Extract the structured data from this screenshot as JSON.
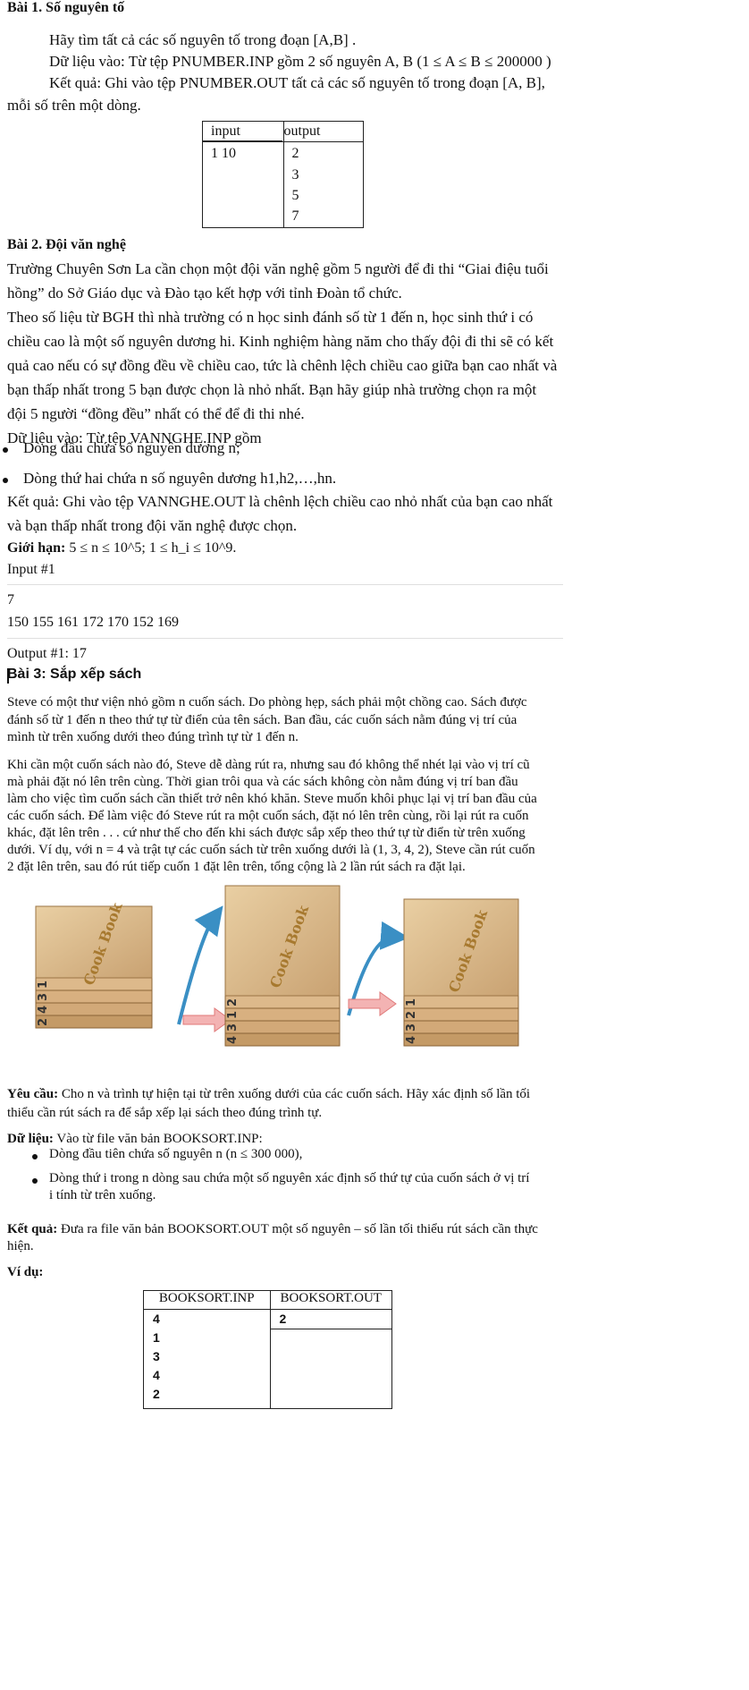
{
  "bai1": {
    "title": "Bài 1. Số nguyên tố",
    "p1": "Hãy tìm tất cả các số nguyên tố trong đoạn [A,B] .",
    "p2": "Dữ liệu vào: Từ tệp PNUMBER.INP gồm 2 số nguyên A, B (1 ≤ A ≤ B ≤ 200000 )",
    "p3a": "Kết quả: Ghi vào tệp PNUMBER.OUT tất cả các số nguyên tố trong đoạn [A, B],",
    "p3b": "mỗi số trên một dòng.",
    "table": {
      "headers": [
        "input",
        "output"
      ],
      "input_lines": [
        "1 10"
      ],
      "output_lines": [
        "2",
        "3",
        "5",
        "7"
      ]
    }
  },
  "bai2": {
    "title": "Bài 2. Đội văn nghệ",
    "lines": [
      "Trường Chuyên Sơn La cần chọn một đội văn nghệ gồm 5 người để đi thi “Giai điệu tuổi",
      "hồng” do Sở Giáo dục và Đào tạo kết hợp với tỉnh Đoàn tổ chức.",
      "Theo số liệu từ BGH thì nhà trường có n học sinh đánh số từ 1 đến n, học sinh thứ i có",
      "chiều cao là một số nguyên dương hi. Kinh nghiệm hàng năm cho thấy đội đi thi sẽ có kết",
      "quả cao nếu có sự đồng đều về chiều cao, tức là chênh lệch chiều cao giữa bạn cao nhất và",
      "bạn thấp nhất trong 5 bạn được chọn là nhỏ nhất. Bạn hãy giúp nhà trường chọn ra một",
      "đội 5 người “đồng đều” nhất có thể để đi thi nhé.",
      "Dữ liệu vào: Từ tệp VANNGHE.INP gồm"
    ],
    "bullets": [
      "Dòng đầu chứa số nguyên dương n;",
      "Dòng thứ hai chứa n số nguyên dương h1,h2,…,hn."
    ],
    "result_a": "Kết quả: Ghi vào tệp VANNGHE.OUT là chênh lệch chiều cao nhỏ nhất của bạn cao nhất",
    "result_b": "và bạn thấp nhất trong đội văn nghệ được chọn.",
    "limit_label": "Giới hạn:",
    "limit_text": "5 ≤ n ≤ 10^5; 1 ≤ h_i ≤ 10^9.",
    "input_label": "Input #1",
    "input_line1": "7",
    "input_line2": "150 155 161 172 170 152 169",
    "output_label": "Output #1: 17"
  },
  "bai3": {
    "title": "Bài 3: Sắp xếp sách",
    "para1": [
      "Steve có một thư viện nhỏ gồm n cuốn sách. Do phòng hẹp, sách phải một chồng cao. Sách được",
      "đánh số từ 1 đến n theo thứ tự từ điển của tên sách. Ban đầu, các cuốn sách nằm đúng vị trí của",
      "mình từ trên xuống dưới theo đúng trình tự từ 1 đến n."
    ],
    "para2": [
      "Khi cần một cuốn sách nào đó, Steve dễ dàng rút ra, nhưng sau đó không thể nhét lại vào vị trí cũ",
      "mà phải đặt nó lên trên cùng. Thời gian trôi qua và các sách không còn nằm đúng vị trí ban đầu",
      "làm cho việc tìm cuốn sách cần thiết trở nên khó khăn. Steve muốn khôi phục lại vị trí ban đầu của",
      "các cuốn sách. Để làm việc đó Steve rút ra một cuốn sách, đặt nó lên trên cùng, rồi lại rút ra cuốn",
      "khác, đặt lên trên . . . cứ như thế cho đến khi sách được sắp xếp theo thứ tự từ điển từ trên xuống",
      "dưới. Ví dụ, với n = 4 và trật tự các cuốn sách từ trên xuống dưới là (1, 3, 4, 2), Steve cần rút cuốn",
      "2 đặt lên trên, sau đó rút tiếp cuốn 1 đặt lên trên, tổng cộng là 2 lần rút sách ra đặt lại."
    ],
    "figure": {
      "cover_text": "Cook Book",
      "stack1": [
        "1",
        "3",
        "4",
        "2"
      ],
      "stack2": [
        "2",
        "1",
        "3",
        "4"
      ],
      "stack3": [
        "1",
        "2",
        "3",
        "4"
      ]
    },
    "req_label": "Yêu cầu:",
    "req_a": "Cho n và trình tự hiện tại từ trên xuống dưới của các cuốn sách. Hãy xác định số lần tối",
    "req_b": "thiểu cần rút sách ra để sắp xếp lại sách theo đúng trình tự.",
    "data_label": "Dữ liệu:",
    "data_text": "Vào từ file văn bản BOOKSORT.INP:",
    "data_bullets": [
      "Dòng đầu tiên chứa số nguyên n (n ≤ 300 000),",
      "Dòng thứ i trong n dòng sau chứa một số nguyên xác định số thứ tự của cuốn sách ở vị trí",
      "i tính từ trên xuống."
    ],
    "result_label": "Kết quả:",
    "result_a": "Đưa ra file văn bản BOOKSORT.OUT một số nguyên – số lần tối thiểu rút sách cần thực",
    "result_b": "hiện.",
    "example_label": "Ví dụ:",
    "table": {
      "headers": [
        "BOOKSORT.INP",
        "BOOKSORT.OUT"
      ],
      "input_lines": [
        "4",
        "1",
        "3",
        "4",
        "2"
      ],
      "output_lines": [
        "2"
      ]
    }
  }
}
